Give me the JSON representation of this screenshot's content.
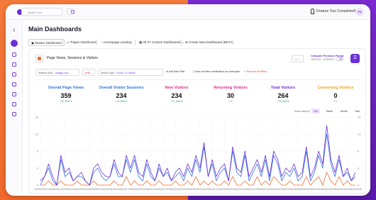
{
  "browser": {
    "url": "ranjeb.com"
  },
  "topbar": {
    "tour_label": "Feature Tour Completed!",
    "user_initials": "PS"
  },
  "page_title": "Main Dashboards",
  "tabs": [
    "Master Dashboard",
    "Pages Dashboard",
    "Homepage-Landing",
    "All 27 Custom Dashboards",
    "Create New Dashboard (BETA)"
  ],
  "panel": {
    "title": "Page Views, Sessions & Visitors",
    "download_label": "⇩ ⌄",
    "compare_title": "Compare Previous Period",
    "compare_range": "18/5/2024 - 10/18/2024",
    "filters": [
      {
        "label": "Referrer URL",
        "value": "chatgpt.com"
      },
      {
        "label": "AND",
        "value": ""
      },
      {
        "label": "Device Type",
        "value": "Phone +3 Others"
      }
    ],
    "add_filter": "Add New Filter",
    "save_filter": "Save set filter combination as a template",
    "remove_filters": "Remove All Filters"
  },
  "metrics": [
    {
      "label": "Overall Page Views",
      "value": "359",
      "change": "+11,800%",
      "color": "#2f6fe0"
    },
    {
      "label": "Overall Visitor Sessions",
      "value": "234",
      "change": "+11,600%",
      "color": "#2f6fe0"
    },
    {
      "label": "New Visitors",
      "value": "234",
      "change": "+11,600%",
      "color": "#e02a8a"
    },
    {
      "label": "Returning Visitors",
      "value": "30",
      "change": "0%",
      "color": "#e02a8a"
    },
    {
      "label": "Total Visitors",
      "value": "264",
      "change": "+13,100%",
      "color": "#6b2fd6"
    },
    {
      "label": "Converting Visitors",
      "value": "0",
      "change": "0%",
      "color": "#f0a020"
    }
  ],
  "range": {
    "label": "Show data by:",
    "options": [
      "Day",
      "Week",
      "Month",
      "Year"
    ],
    "active": "Day"
  },
  "colors": {
    "accent": "#6b2fd6",
    "orange": "#f26a2c",
    "blue": "#2f6fe0"
  },
  "icons": [
    "shield-icon",
    "calendar-icon",
    "dashboard-icon",
    "plus-icon",
    "download-icon",
    "user-icon"
  ],
  "chart_data": {
    "type": "line",
    "ylim": [
      0,
      16
    ],
    "yticks": [
      "16",
      "12",
      "8",
      "4",
      "0"
    ],
    "categories": [
      "12/09/2024",
      "12/16/2024",
      "12/23/2024",
      "12/30/2024",
      "01/06/2025",
      "01/13/2025",
      "01/20/2025",
      "01/27/2025",
      "02/03/2025",
      "02/10/2025",
      "02/17/2025",
      "02/24/2025",
      "03/03/2025",
      "03/10/2025",
      "03/17/2025",
      "03/24/2025",
      "03/31/2025",
      "04/07/2025",
      "04/14/2025",
      "04/21/2025",
      "04/28/2025",
      "05/05/2025",
      "05/12/2025",
      "05/19/2025",
      "05/26/2025",
      "06/02/2025"
    ],
    "series": [
      {
        "color": "#6b2fd6",
        "values": [
          1,
          2,
          5,
          2,
          0,
          7,
          3,
          4,
          1,
          2,
          3,
          1,
          0,
          4,
          5,
          3,
          2,
          2,
          6,
          3,
          2,
          7,
          4,
          7,
          3,
          2,
          6,
          3,
          1,
          5,
          2,
          4,
          1,
          3,
          4,
          2,
          5,
          3,
          7,
          4,
          10,
          2,
          6,
          2,
          4,
          5,
          1,
          9,
          4,
          3,
          8,
          2,
          4,
          6,
          3,
          7,
          2,
          8,
          6,
          2,
          4,
          3,
          5,
          2,
          3,
          9,
          2,
          4,
          8,
          5,
          14,
          6,
          3,
          7,
          2,
          4,
          1,
          3
        ]
      },
      {
        "color": "#2f6fe0",
        "values": [
          0,
          2,
          4,
          1,
          0,
          6,
          2,
          3,
          1,
          2,
          2,
          1,
          0,
          3,
          4,
          2,
          1,
          2,
          5,
          2,
          2,
          6,
          3,
          6,
          2,
          1,
          5,
          2,
          1,
          4,
          2,
          3,
          1,
          2,
          3,
          1,
          4,
          2,
          6,
          3,
          9,
          2,
          5,
          1,
          3,
          4,
          1,
          8,
          3,
          2,
          7,
          1,
          3,
          5,
          2,
          6,
          1,
          7,
          5,
          1,
          3,
          2,
          4,
          1,
          2,
          8,
          1,
          3,
          7,
          4,
          12,
          5,
          2,
          6,
          2,
          3,
          1,
          2
        ]
      },
      {
        "color": "#f26a2c",
        "values": [
          0,
          0,
          1,
          0,
          0,
          1,
          0,
          0,
          0,
          1,
          0,
          0,
          0,
          1,
          0,
          0,
          0,
          0,
          1,
          0,
          0,
          2,
          0,
          1,
          0,
          0,
          1,
          0,
          0,
          1,
          0,
          0,
          0,
          1,
          0,
          0,
          1,
          0,
          2,
          0,
          1,
          0,
          1,
          0,
          0,
          1,
          0,
          2,
          0,
          0,
          1,
          0,
          0,
          2,
          0,
          1,
          0,
          2,
          1,
          0,
          0,
          1,
          0,
          0,
          0,
          2,
          0,
          1,
          2,
          0,
          3,
          1,
          0,
          2,
          0,
          1,
          0,
          0
        ]
      }
    ]
  }
}
